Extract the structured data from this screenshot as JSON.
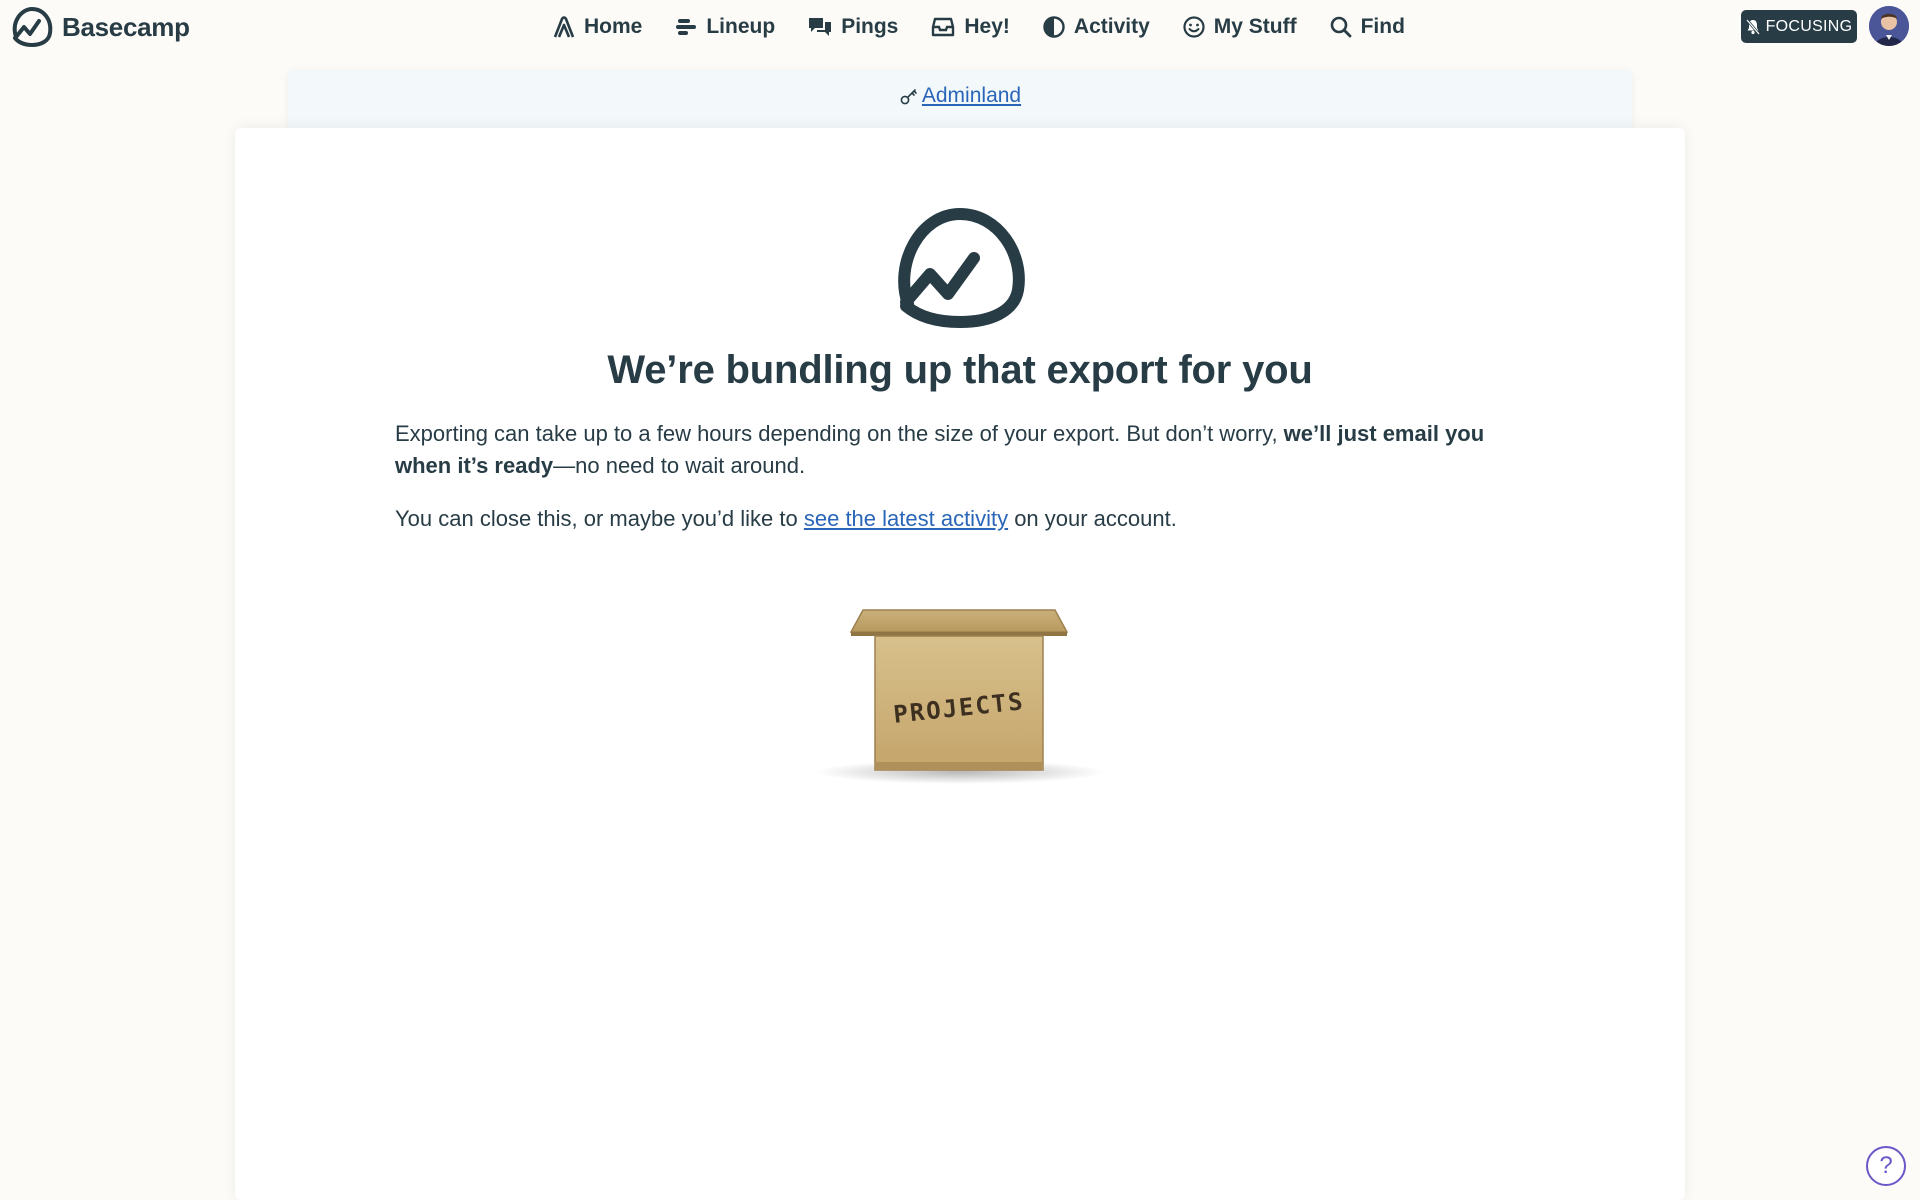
{
  "brand": {
    "name": "Basecamp"
  },
  "nav": {
    "items": [
      {
        "label": "Home",
        "icon": "home-icon"
      },
      {
        "label": "Lineup",
        "icon": "lineup-icon"
      },
      {
        "label": "Pings",
        "icon": "pings-icon"
      },
      {
        "label": "Hey!",
        "icon": "inbox-icon"
      },
      {
        "label": "Activity",
        "icon": "activity-icon"
      },
      {
        "label": "My Stuff",
        "icon": "smiley-icon"
      },
      {
        "label": "Find",
        "icon": "search-icon"
      }
    ]
  },
  "focus": {
    "label": "FOCUSING",
    "icon": "bell-off-icon"
  },
  "admin": {
    "label": "Adminland",
    "icon": "key-icon"
  },
  "main": {
    "title": "We’re bundling up that export for you",
    "p1_text": "Exporting can take up to a few hours depending on the size of your export. But don’t worry, ",
    "p1_bold": "we’ll just email you when it’s ready",
    "p1_tail": "—no need to wait around.",
    "p2_pre": "You can close this, or maybe you’d like to ",
    "p2_link": "see the latest activity",
    "p2_post": " on your account.",
    "box_label": "PROJECTS"
  },
  "help": {
    "label": "?"
  },
  "colors": {
    "text": "#283c46",
    "link": "#2a66b8",
    "accent": "#6b57c8",
    "background": "#fdfbf7"
  }
}
